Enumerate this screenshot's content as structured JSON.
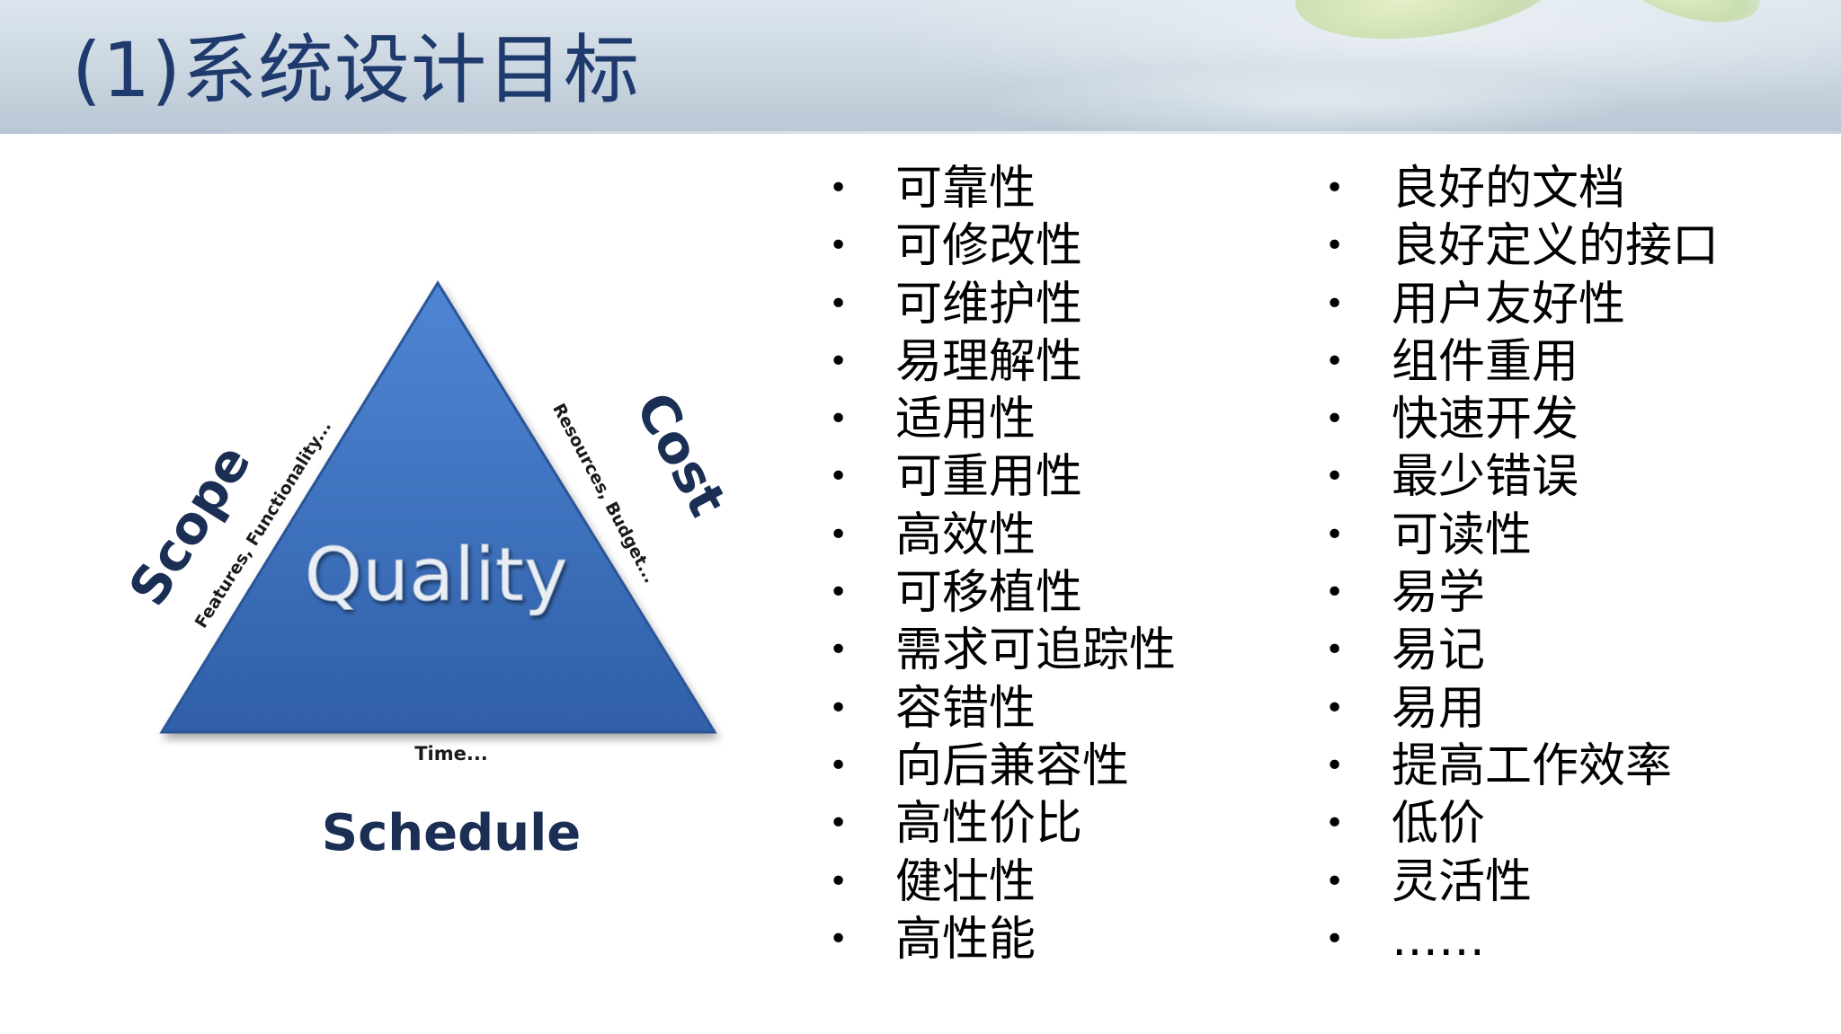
{
  "slide": {
    "title": "(1)系统设计目标"
  },
  "diagram": {
    "center_label": "Quality",
    "left_side_label": "Scope",
    "left_side_sublabel": "Features, Functionality...",
    "right_side_label": "Cost",
    "right_side_sublabel": "Resources, Budget...",
    "bottom_sublabel": "Time...",
    "bottom_label": "Schedule",
    "triangle_color": "#3a6fbf"
  },
  "lists": {
    "bullet_symbol": "•",
    "left": [
      "可靠性",
      "可修改性",
      "可维护性",
      "易理解性",
      "适用性",
      "可重用性",
      "高效性",
      "可移植性",
      "需求可追踪性",
      "容错性",
      "向后兼容性",
      "高性价比",
      "健壮性",
      "高性能"
    ],
    "right": [
      "良好的文档",
      "良好定义的接口",
      "用户友好性",
      "组件重用",
      "快速开发",
      "最少错误",
      "可读性",
      "易学",
      "易记",
      "易用",
      "提高工作效率",
      "低价",
      "灵活性",
      "……"
    ]
  }
}
